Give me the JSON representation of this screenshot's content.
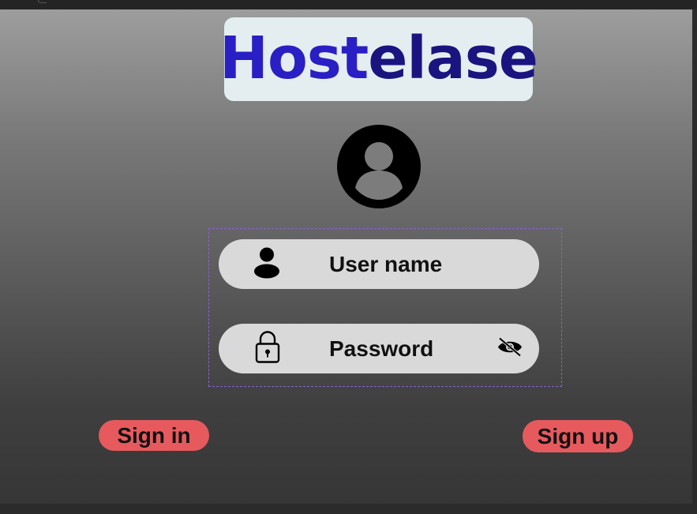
{
  "app": {
    "logo_part1": "Host",
    "logo_part2": "elase"
  },
  "form": {
    "username_label": "User name",
    "password_label": "Password"
  },
  "actions": {
    "sign_in_label": "Sign in",
    "sign_up_label": "Sign up"
  },
  "icons": {
    "avatar": "user-circle-icon",
    "username": "user-icon",
    "password": "lock-icon",
    "toggle_visibility": "eye-off-icon"
  },
  "colors": {
    "logo_primary": "#2a1fc4",
    "logo_secondary": "#1a1480",
    "logo_background": "#e4eef0",
    "field_background": "#d9d9d9",
    "button_background": "#e65a5e",
    "selection_outline": "#8a63d2"
  }
}
